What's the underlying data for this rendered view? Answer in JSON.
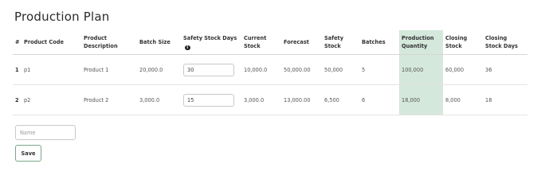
{
  "page": {
    "title": "Production Plan"
  },
  "table": {
    "headers": {
      "index": "#",
      "product_code": "Product Code",
      "product_description": "Product Description",
      "batch_size": "Batch Size",
      "safety_stock_days": "Safety Stock Days",
      "current_stock_line1": "Current",
      "current_stock_line2": "Stock",
      "forecast": "Forecast",
      "safety_stock": "Safety Stock",
      "batches": "Batches",
      "production_quantity_line1": "Production",
      "production_quantity_line2": "Quantity",
      "closing_stock_line1": "Closing",
      "closing_stock_line2": "Stock",
      "closing_stock_days_line1": "Closing",
      "closing_stock_days_line2": "Stock Days"
    },
    "info_icon": "info-icon",
    "highlight_color": "#d5e8dc",
    "rows": [
      {
        "index": "1",
        "product_code": "p1",
        "product_description": "Product 1",
        "batch_size": "20,000.0",
        "safety_stock_days": "30",
        "current_stock": "10,000.0",
        "forecast": "50,000.00",
        "safety_stock": "50,000",
        "batches": "5",
        "production_quantity": "100,000",
        "closing_stock": "60,000",
        "closing_stock_days": "36"
      },
      {
        "index": "2",
        "product_code": "p2",
        "product_description": "Product 2",
        "batch_size": "3,000.0",
        "safety_stock_days": "15",
        "current_stock": "3,000.0",
        "forecast": "13,000.00",
        "safety_stock": "6,500",
        "batches": "6",
        "production_quantity": "18,000",
        "closing_stock": "8,000",
        "closing_stock_days": "18"
      }
    ]
  },
  "form": {
    "name_placeholder": "Name",
    "name_value": "",
    "save_label": "Save"
  }
}
